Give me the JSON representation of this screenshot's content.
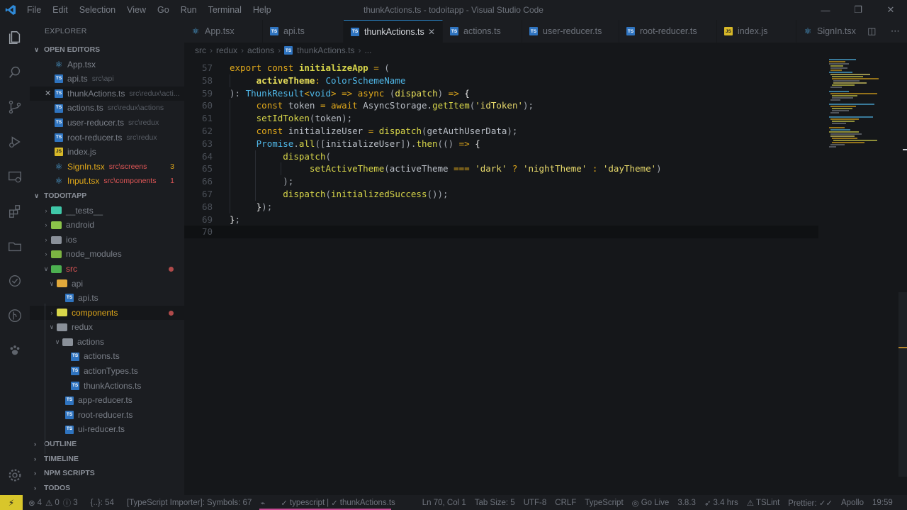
{
  "window": {
    "title": "thunkActions.ts - todoitapp - Visual Studio Code",
    "menu": [
      "File",
      "Edit",
      "Selection",
      "View",
      "Go",
      "Run",
      "Terminal",
      "Help"
    ]
  },
  "sidebar": {
    "title": "EXPLORER",
    "open_editors_label": "OPEN EDITORS",
    "open_editors": [
      {
        "name": "App.tsx",
        "desc": "",
        "icon": "react-icon",
        "badge": ""
      },
      {
        "name": "api.ts",
        "desc": "src\\api",
        "icon": "ts-icon",
        "badge": ""
      },
      {
        "name": "thunkActions.ts",
        "desc": "src\\redux\\acti...",
        "icon": "ts-icon",
        "badge": ""
      },
      {
        "name": "actions.ts",
        "desc": "src\\redux\\actions",
        "icon": "ts-icon",
        "badge": ""
      },
      {
        "name": "user-reducer.ts",
        "desc": "src\\redux",
        "icon": "ts-icon",
        "badge": ""
      },
      {
        "name": "root-reducer.ts",
        "desc": "src\\redux",
        "icon": "ts-icon",
        "badge": ""
      },
      {
        "name": "index.js",
        "desc": "",
        "icon": "js-icon",
        "badge": ""
      },
      {
        "name": "SignIn.tsx",
        "desc": "src\\screens",
        "icon": "react-icon",
        "badge": "3"
      },
      {
        "name": "Input.tsx",
        "desc": "src\\components",
        "icon": "react-icon",
        "badge": "1"
      }
    ],
    "project_label": "TODOITAPP",
    "tree": {
      "tests": "__tests__",
      "android": "android",
      "ios": "ios",
      "node_modules": "node_modules",
      "src": "src",
      "api": "api",
      "api_ts": "api.ts",
      "components": "components",
      "redux": "redux",
      "actions": "actions",
      "actions_ts": "actions.ts",
      "actionTypes_ts": "actionTypes.ts",
      "thunkActions_ts": "thunkActions.ts",
      "app_reducer": "app-reducer.ts",
      "root_reducer": "root-reducer.ts",
      "ui_reducer": "ui-reducer.ts"
    },
    "sections": [
      "OUTLINE",
      "TIMELINE",
      "NPM SCRIPTS",
      "TODOS"
    ]
  },
  "tabs": [
    {
      "label": "App.tsx",
      "icon": "react-icon"
    },
    {
      "label": "api.ts",
      "icon": "ts-icon"
    },
    {
      "label": "thunkActions.ts",
      "icon": "ts-icon",
      "active": true
    },
    {
      "label": "actions.ts",
      "icon": "ts-icon"
    },
    {
      "label": "user-reducer.ts",
      "icon": "ts-icon"
    },
    {
      "label": "root-reducer.ts",
      "icon": "ts-icon"
    },
    {
      "label": "index.js",
      "icon": "js-icon"
    },
    {
      "label": "SignIn.tsx",
      "icon": "react-icon"
    }
  ],
  "breadcrumb": [
    "src",
    "redux",
    "actions",
    "thunkActions.ts",
    "..."
  ],
  "editor": {
    "line_numbers": [
      "57",
      "58",
      "59",
      "60",
      "61",
      "62",
      "63",
      "64",
      "65",
      "66",
      "67",
      "68",
      "69",
      "70"
    ],
    "current_line": "70"
  },
  "status": {
    "errors": "4",
    "warnings": "0",
    "infos": "3",
    "position_hint": "{..}: 54",
    "ts_importer": "[TypeScript Importer]: Symbols: 67",
    "language_mode": "typescript",
    "file": "thunkActions.ts",
    "cursor": "Ln 70, Col 1",
    "tab_size": "Tab Size: 5",
    "encoding": "UTF-8",
    "eol": "CRLF",
    "language": "TypeScript",
    "live": "Go Live",
    "ts_version": "3.8.3",
    "time_spent": "3.4 hrs",
    "lint": "TSLint",
    "prettier": "Prettier: ✓✓",
    "apollo": "Apollo",
    "clock": "19:59"
  },
  "colors": {
    "accent_remote": "#d8c62b",
    "keyword": "#e0a81a",
    "function": "#d8d64a",
    "type": "#4fb6e6",
    "string": "#e7d96b",
    "error_text": "#e05656",
    "modified_text": "#e0a81a"
  }
}
